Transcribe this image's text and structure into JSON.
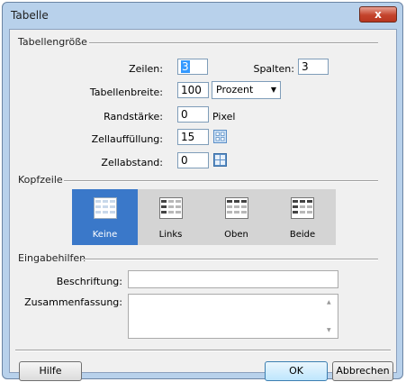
{
  "window": {
    "title": "Tabelle",
    "close_glyph": "x"
  },
  "tabellengroesse": {
    "section_label": "Tabellengröße",
    "zeilen": {
      "label": "Zeilen:",
      "value": "3"
    },
    "spalten": {
      "label": "Spalten:",
      "value": "3"
    },
    "tabellenbreite": {
      "label": "Tabellenbreite:",
      "value": "100",
      "unit": "Prozent"
    },
    "randstaerke": {
      "label": "Randstärke:",
      "value": "0",
      "unit": "Pixel"
    },
    "zellauffuellung": {
      "label": "Zellauffüllung:",
      "value": "15"
    },
    "zellabstand": {
      "label": "Zellabstand:",
      "value": "0"
    }
  },
  "kopfzeile": {
    "section_label": "Kopfzeile",
    "options": [
      {
        "label": "Keine",
        "selected": true
      },
      {
        "label": "Links",
        "selected": false
      },
      {
        "label": "Oben",
        "selected": false
      },
      {
        "label": "Beide",
        "selected": false
      }
    ]
  },
  "eingabehilfen": {
    "section_label": "Eingabehilfen",
    "beschriftung": {
      "label": "Beschriftung:",
      "value": ""
    },
    "zusammenfassung": {
      "label": "Zusammenfassung:",
      "value": ""
    }
  },
  "buttons": {
    "hilfe": "Hilfe",
    "ok": "OK",
    "abbrechen": "Abbrechen"
  },
  "colors": {
    "selected_bg": "#3a78c9",
    "title_bar": "#b8d1eb",
    "close_button": "#c4442c"
  }
}
